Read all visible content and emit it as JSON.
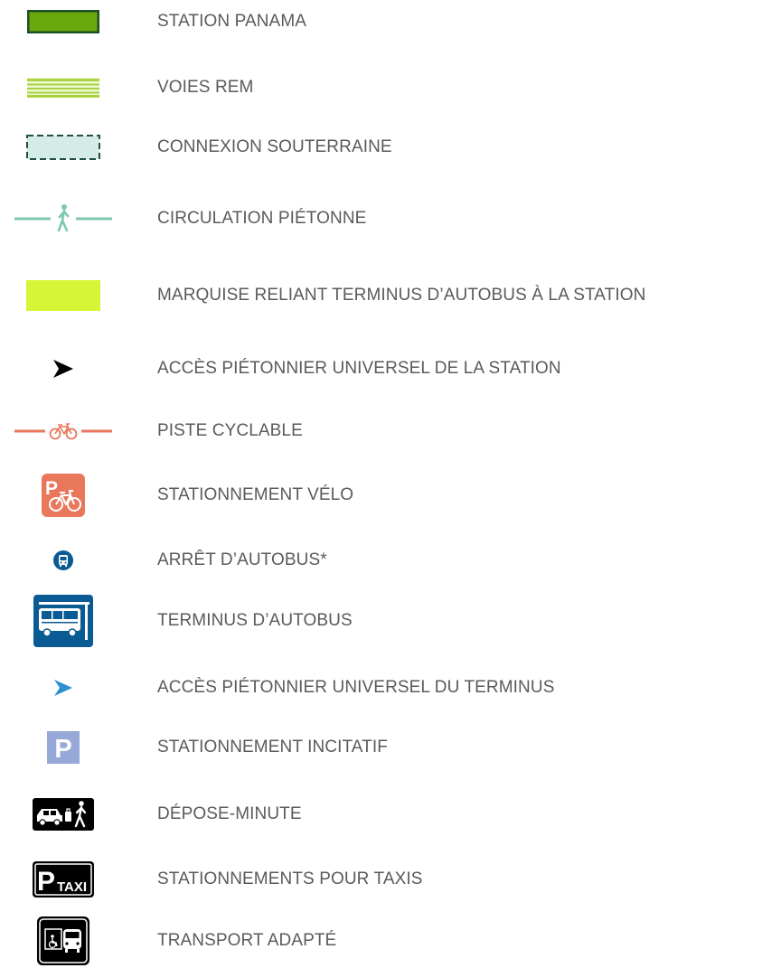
{
  "legend": {
    "items": [
      {
        "icon": "station-rectangle-icon",
        "label": "STATION PANAMA"
      },
      {
        "icon": "rail-tracks-icon",
        "label": "VOIES REM"
      },
      {
        "icon": "underground-connection-icon",
        "label": "CONNEXION SOUTERRAINE"
      },
      {
        "icon": "pedestrian-path-icon",
        "label": "CIRCULATION PIÉTONNE"
      },
      {
        "icon": "canopy-rectangle-icon",
        "label": "MARQUISE RELIANT TERMINUS D’AUTOBUS À LA STATION"
      },
      {
        "icon": "station-access-arrow-icon",
        "label": "ACCÈS PIÉTONNIER UNIVERSEL DE LA STATION"
      },
      {
        "icon": "bike-path-icon",
        "label": "PISTE CYCLABLE"
      },
      {
        "icon": "bike-parking-icon",
        "label": "STATIONNEMENT VÉLO"
      },
      {
        "icon": "bus-stop-icon",
        "label": "ARRÊT D’AUTOBUS*"
      },
      {
        "icon": "bus-terminal-icon",
        "label": "TERMINUS D’AUTOBUS"
      },
      {
        "icon": "terminal-access-arrow-icon",
        "label": "ACCÈS PIÉTONNIER UNIVERSEL DU TERMINUS"
      },
      {
        "icon": "park-and-ride-icon",
        "label": "STATIONNEMENT INCITATIF"
      },
      {
        "icon": "drop-off-icon",
        "label": "DÉPOSE-MINUTE"
      },
      {
        "icon": "taxi-parking-icon",
        "label": "STATIONNEMENTS POUR TAXIS"
      },
      {
        "icon": "paratransit-icon",
        "label": "TRANSPORT ADAPTÉ"
      }
    ],
    "icon_text": {
      "bike_parking_letter": "P",
      "park_and_ride_letter": "P",
      "taxi_letter": "P",
      "taxi_word": "TAXI"
    }
  },
  "colors": {
    "label_text": "#5a5a5a",
    "station_fill": "#6aa80e",
    "station_border": "#1f4f25",
    "rail_green": "#a7d53b",
    "underground_fill": "#d5ebe7",
    "underground_border": "#1f4f45",
    "pedestrian_teal": "#7cc8b1",
    "canopy_yellow": "#d6f537",
    "bike_orange": "#e9775c",
    "bus_blue": "#0a5a94",
    "terminal_arrow_blue": "#2b8fd1",
    "parking_lavender": "#96a8d8",
    "black": "#000000"
  }
}
